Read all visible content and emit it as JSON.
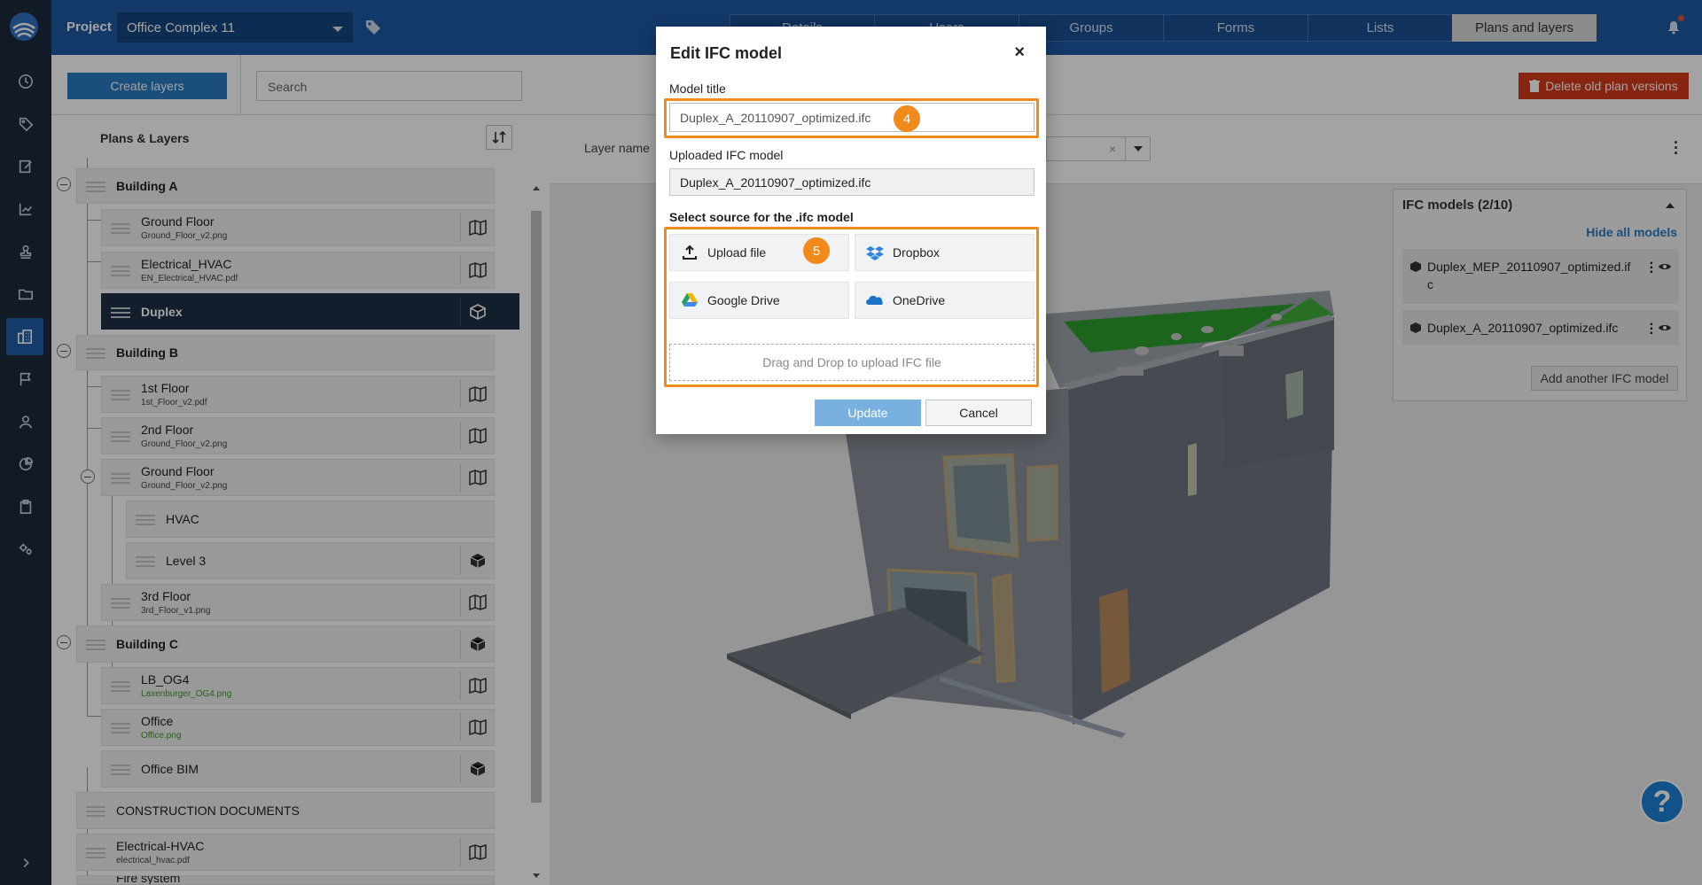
{
  "header": {
    "project_label": "Project",
    "project_value": "Office Complex 11",
    "tabs": [
      "Details",
      "Users",
      "Groups",
      "Forms",
      "Lists",
      "Plans and layers"
    ],
    "active_tab": "Plans and layers"
  },
  "toolbar": {
    "create_layers": "Create layers",
    "search_placeholder": "Search",
    "delete_old": "Delete old plan versions"
  },
  "tree": {
    "title": "Plans & Layers",
    "items": [
      {
        "name": "Building A"
      },
      {
        "name": "Ground Floor",
        "file": "Ground_Floor_v2.png"
      },
      {
        "name": "Electrical_HVAC",
        "file": "EN_Electrical_HVAC.pdf"
      },
      {
        "name": "Duplex"
      },
      {
        "name": "Building B"
      },
      {
        "name": "1st Floor",
        "file": "1st_Floor_v2.pdf"
      },
      {
        "name": "2nd Floor",
        "file": "Ground_Floor_v2.png"
      },
      {
        "name": "Ground Floor",
        "file": "Ground_Floor_v2.png"
      },
      {
        "name": "HVAC"
      },
      {
        "name": "Level 3"
      },
      {
        "name": "3rd Floor",
        "file": "3rd_Floor_v1.png"
      },
      {
        "name": "Building C"
      },
      {
        "name": "LB_OG4",
        "file": "Laxenburger_OG4.png"
      },
      {
        "name": "Office",
        "file": "Office.png"
      },
      {
        "name": "Office BIM"
      },
      {
        "name": "CONSTRUCTION DOCUMENTS"
      },
      {
        "name": "Electrical-HVAC",
        "file": "electrical_hvac.pdf"
      },
      {
        "name": "Fire system"
      }
    ]
  },
  "viewer": {
    "layer_name_label": "Layer name"
  },
  "ifc_panel": {
    "title": "IFC models (2/10)",
    "hide_all": "Hide all models",
    "models": [
      "Duplex_MEP_20110907_optimized.ifc",
      "Duplex_A_20110907_optimized.ifc"
    ],
    "add_button": "Add another IFC model"
  },
  "modal": {
    "title": "Edit IFC model",
    "close": "×",
    "model_title_label": "Model title",
    "model_title_value": "Duplex_A_20110907_optimized.ifc",
    "uploaded_label": "Uploaded IFC model",
    "uploaded_value": "Duplex_A_20110907_optimized.ifc",
    "source_label": "Select source for the .ifc model",
    "sources": {
      "upload": "Upload file",
      "dropbox": "Dropbox",
      "gdrive": "Google Drive",
      "onedrive": "OneDrive"
    },
    "dropzone": "Drag and Drop to upload IFC file",
    "update": "Update",
    "cancel": "Cancel",
    "step_badges": [
      "4",
      "5"
    ]
  },
  "help": "?",
  "colors": {
    "brand_blue": "#1e5aa5",
    "rail": "#1b2a3b",
    "highlight_orange": "#f08c1e",
    "delete_red": "#d43b1c"
  }
}
